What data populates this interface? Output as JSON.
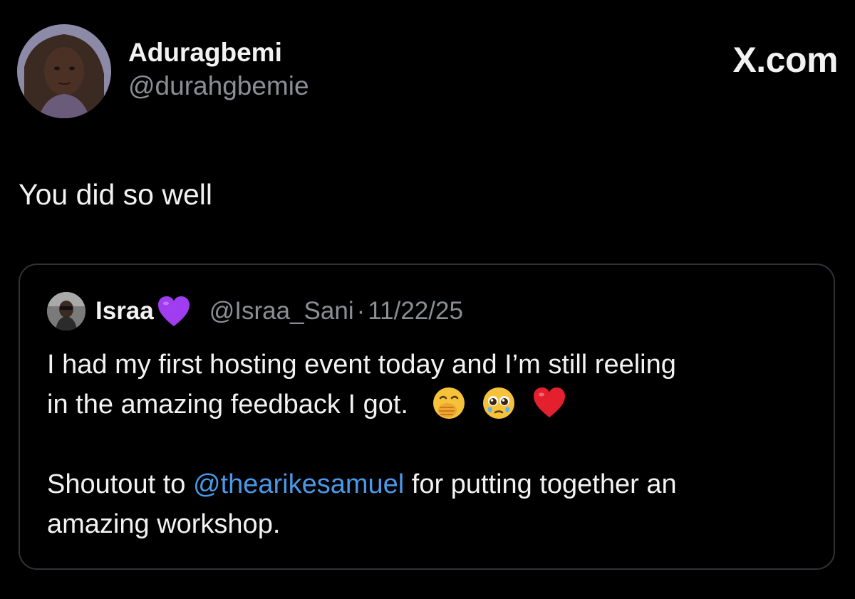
{
  "post": {
    "author_name": "Aduragbemi",
    "author_handle": "@durahgbemie",
    "brand": "X.com",
    "text": "You did so well"
  },
  "quoted": {
    "author_name": "Israa",
    "author_handle": "@Israa_Sani",
    "separator": "·",
    "date": "11/22/25",
    "line1": "I had my first hosting event today and I’m still reeling",
    "line2": "in the amazing feedback I got.",
    "line3_prefix": "Shoutout to",
    "mention": "@thearikesamuel",
    "line3_suffix": "for putting together an",
    "line4": "amazing workshop.",
    "emojis": [
      "face-with-hand-over-mouth",
      "pleading-face",
      "red-heart"
    ]
  },
  "colors": {
    "background": "#000000",
    "text": "#f2f2f2",
    "muted": "#8b8f94",
    "mention": "#4a99e9",
    "border": "#2f3336",
    "purple_heart": "#a03df0"
  }
}
